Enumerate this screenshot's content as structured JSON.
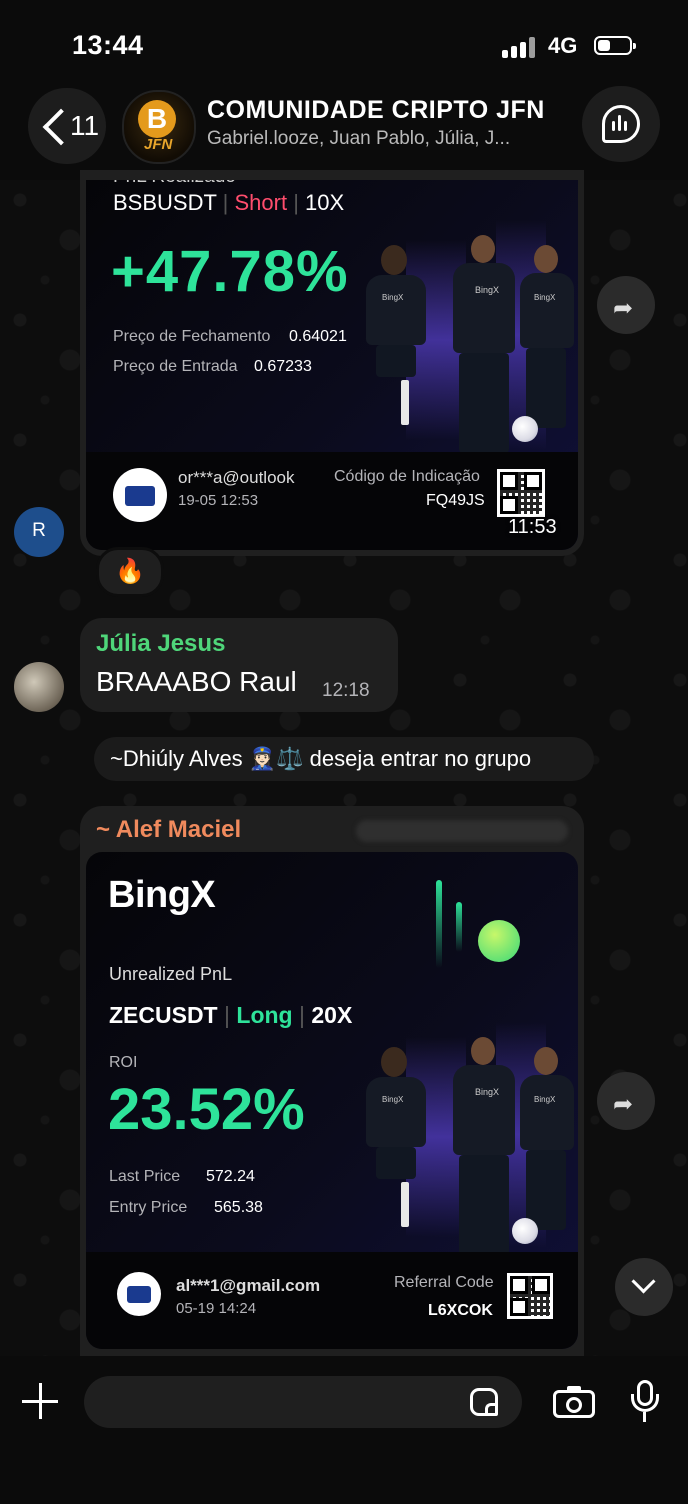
{
  "status_bar": {
    "time": "13:44",
    "network": "4G"
  },
  "header": {
    "back_count": "11",
    "avatar_text": "JFN",
    "avatar_coin": "B",
    "title": "COMUNIDADE CRIPTO JFN",
    "members": "Gabriel.looze, Juan Pablo, Júlia, J..."
  },
  "message1": {
    "sender_initial": "R",
    "card_label_partial": "PnL Realizado",
    "pair": "BSBUSDT",
    "direction": "Short",
    "leverage": "10X",
    "pnl": "+47.78%",
    "close_label": "Preço de Fechamento",
    "close_value": "0.64021",
    "entry_label": "Preço de Entrada",
    "entry_value": "0.67233",
    "email": "or***a@outlook",
    "date": "19-05 12:53",
    "ref_label": "Código de Indicação",
    "ref_code": "FQ49JS",
    "time": "11:53",
    "reaction": "🔥"
  },
  "message2": {
    "sender": "Júlia Jesus",
    "text": "BRAAABO Raul",
    "time": "12:18"
  },
  "system_message": {
    "text": "~Dhiúly Alves 👮🏻‍♀️⚖️ deseja entrar no grupo"
  },
  "message3": {
    "sender": "~ Alef Maciel",
    "brand": "BingX",
    "card_label": "Unrealized PnL",
    "pair": "ZECUSDT",
    "direction": "Long",
    "leverage": "20X",
    "roi_label": "ROI",
    "roi": "23.52%",
    "last_label": "Last Price",
    "last_value": "572.24",
    "entry_label": "Entry Price",
    "entry_value": "565.38",
    "email": "al***1@gmail.com",
    "date": "05-19 14:24",
    "ref_label": "Referral Code",
    "ref_code": "L6XCOK"
  },
  "jersey_text": "BingX",
  "colors": {
    "green": "#2ee39a",
    "red": "#ff4d6d",
    "sender_green": "#4fd67a",
    "sender_orange": "#f08a5d",
    "bubble": "#1f1f1f"
  }
}
